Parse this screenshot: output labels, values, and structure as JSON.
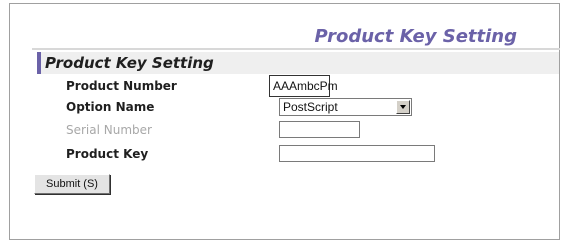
{
  "header": {
    "title": "Product Key Setting"
  },
  "section": {
    "title": "Product Key Setting"
  },
  "form": {
    "product_number": {
      "label": "Product Number",
      "value": "AAAmbcPm"
    },
    "option_name": {
      "label": "Option Name",
      "selected": "PostScript"
    },
    "serial_number": {
      "label": "Serial Number",
      "value": ""
    },
    "product_key": {
      "label": "Product Key",
      "value": ""
    },
    "submit_label": "Submit (S)"
  },
  "colors": {
    "accent": "#6b62a8",
    "section_bg": "#efefef",
    "disabled_text": "#a8a8a8"
  },
  "icons": {
    "select_arrow": "chevron-down-icon"
  }
}
